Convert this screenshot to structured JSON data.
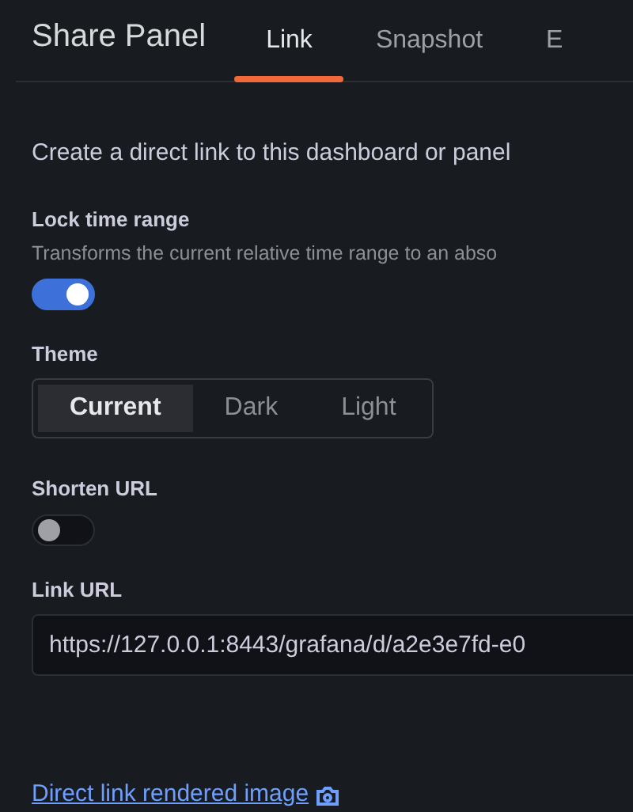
{
  "header": {
    "title": "Share Panel"
  },
  "tabs": [
    {
      "label": "Link",
      "selected": true
    },
    {
      "label": "Snapshot",
      "selected": false
    },
    {
      "label": "E",
      "selected": false
    }
  ],
  "intro": "Create a direct link to this dashboard or panel",
  "lock_time_range": {
    "label": "Lock time range",
    "description": "Transforms the current relative time range to an abso",
    "on": true
  },
  "theme": {
    "label": "Theme",
    "options": [
      {
        "label": "Current",
        "selected": true
      },
      {
        "label": "Dark",
        "selected": false
      },
      {
        "label": "Light",
        "selected": false
      }
    ]
  },
  "shorten_url": {
    "label": "Shorten URL",
    "on": false
  },
  "link_url": {
    "label": "Link URL",
    "value": "https://127.0.0.1:8443/grafana/d/a2e3e7fd-e0"
  },
  "rendered_image_link": "Direct link rendered image"
}
